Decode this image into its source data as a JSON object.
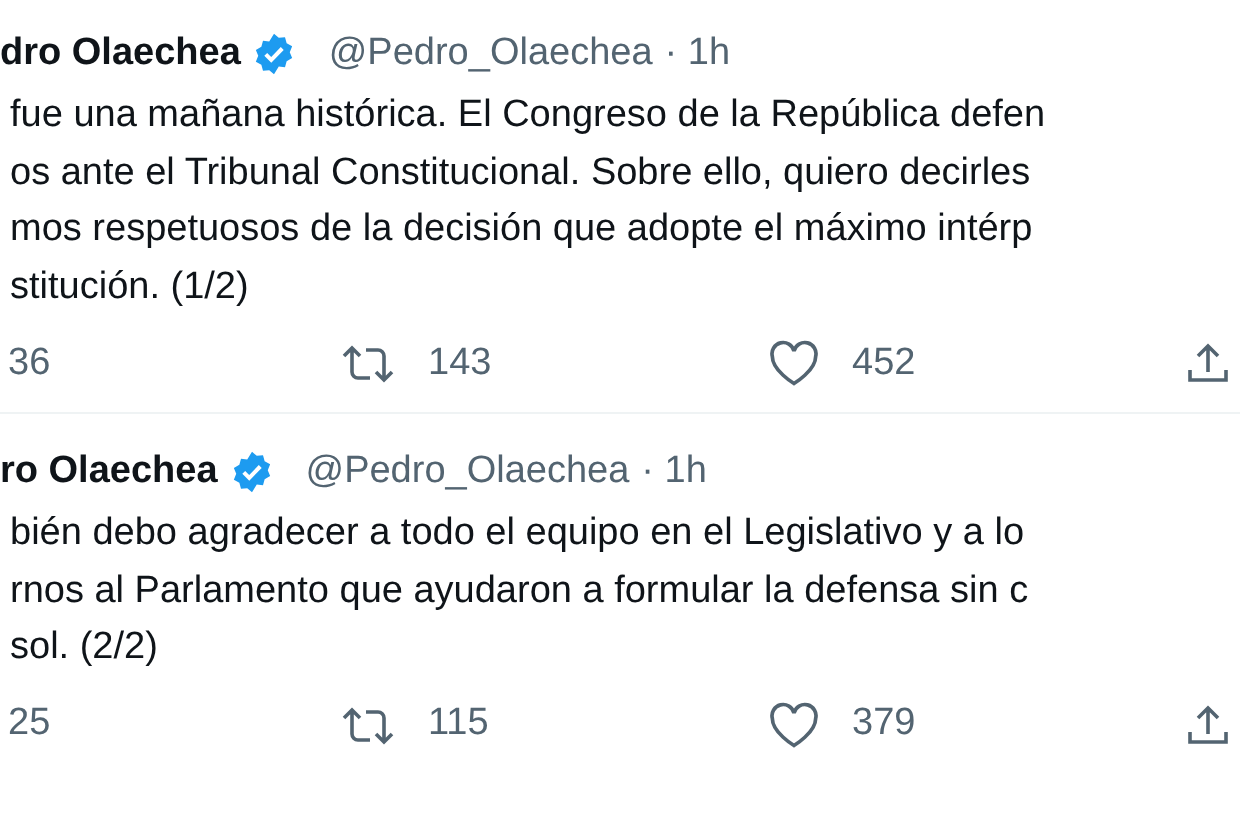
{
  "tweets": [
    {
      "name": "dro Olaechea",
      "verified": true,
      "handle": "@Pedro_Olaechea",
      "time": "· 1h",
      "lines": [
        "fue una mañana histórica. El Congreso de la República defen",
        "os ante el Tribunal Constitucional. Sobre ello, quiero decirles",
        "mos respetuosos de la decisión que adopte el máximo intérp",
        "stitución. (1/2)"
      ],
      "replies": "36",
      "retweets": "143",
      "likes": "452"
    },
    {
      "name": "ro Olaechea",
      "verified": true,
      "handle": "@Pedro_Olaechea",
      "time": "· 1h",
      "lines": [
        "bién debo agradecer a todo el equipo en el Legislativo y a lo",
        "rnos al Parlamento que ayudaron a formular la defensa sin c",
        "sol. (2/2)"
      ],
      "replies": "25",
      "retweets": "115",
      "likes": "379"
    }
  ]
}
